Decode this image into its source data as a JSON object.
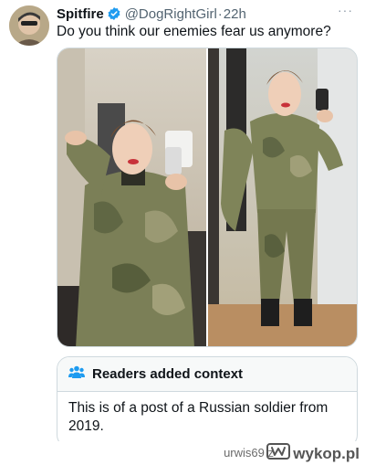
{
  "tweet": {
    "display_name": "Spitfire",
    "handle": "@DogRightGirl",
    "separator": "·",
    "time": "22h",
    "more_label": "···",
    "text": "Do you think our enemies fear us anymore?",
    "verified_icon": "verified-badge-icon",
    "verified_color": "#1d9bf0"
  },
  "media": {
    "photos": [
      {
        "name": "photo-left",
        "icon": "image"
      },
      {
        "name": "photo-right",
        "icon": "image"
      }
    ]
  },
  "context": {
    "title": "Readers added context",
    "icon": "people-icon",
    "body": "This is of a post of a Russian soldier from 2019."
  },
  "footer": {
    "user": "urwis69",
    "connector": "z",
    "brand": "wykop.pl",
    "brand_icon": "wykop-logo-icon"
  }
}
